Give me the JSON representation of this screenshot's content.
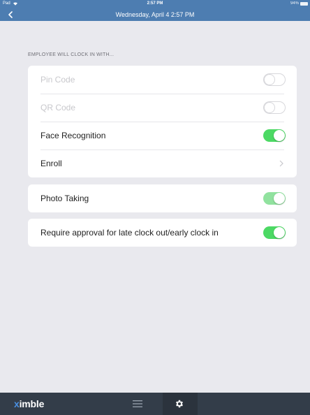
{
  "status_bar": {
    "carrier": "Pad",
    "time": "2:57 PM",
    "battery": "94%",
    "icons": [
      "wifi-icon",
      "battery-icon"
    ]
  },
  "nav": {
    "title": "Wednesday, April 4 2:57 PM",
    "back_icon": "chevron-left-icon"
  },
  "section_header": "EMPLOYEE WILL CLOCK IN WITH...",
  "clock_in_options": [
    {
      "label": "Pin Code",
      "enabled": false,
      "toggle": false
    },
    {
      "label": "QR Code",
      "enabled": false,
      "toggle": false
    },
    {
      "label": "Face Recognition",
      "enabled": true,
      "toggle": true
    },
    {
      "label": "Enroll",
      "enabled": true,
      "chevron": true
    }
  ],
  "photo_taking": {
    "label": "Photo Taking",
    "toggle": true,
    "dim": true
  },
  "approval": {
    "label": "Require approval for late clock out/early clock in",
    "toggle": true
  },
  "tab_bar": {
    "logo_prefix": "x",
    "logo_rest": "imble",
    "icons": [
      "list-icon",
      "gear-icon"
    ]
  },
  "colors": {
    "header": "#4d7db1",
    "toggle_on": "#4cd964",
    "tab_bar": "#333d49"
  }
}
